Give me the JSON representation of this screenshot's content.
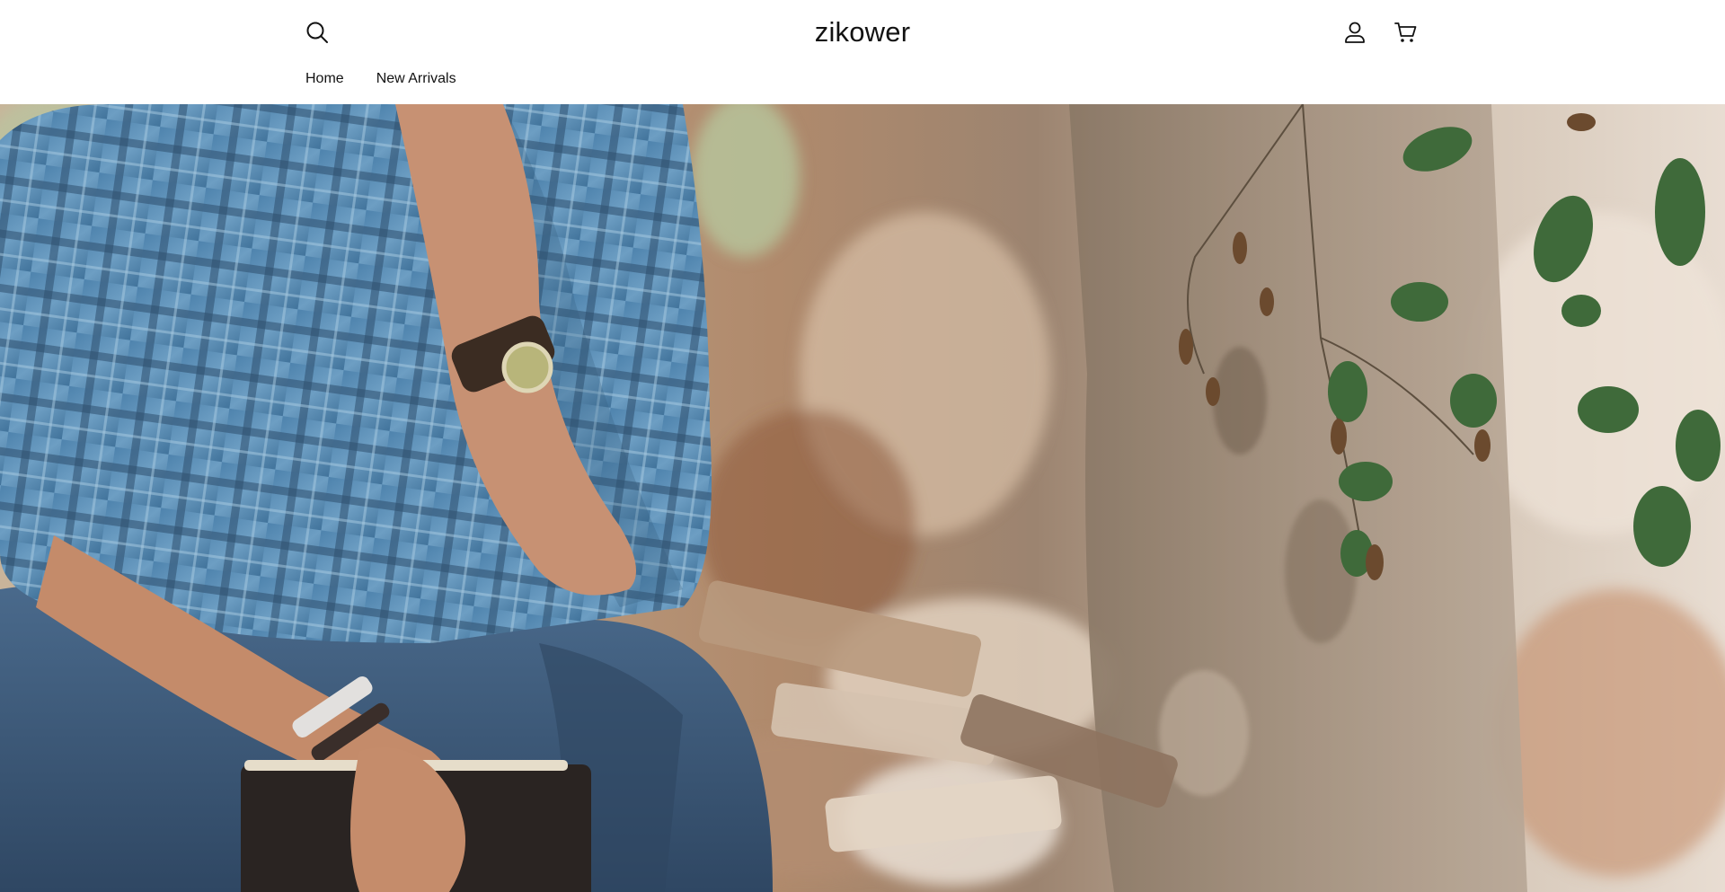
{
  "store": {
    "name": "zikower"
  },
  "header": {
    "icons": {
      "search": "search-icon",
      "account": "account-icon",
      "cart": "cart-icon"
    }
  },
  "nav": {
    "items": [
      {
        "label": "Home"
      },
      {
        "label": "New Arrivals"
      }
    ]
  },
  "hero": {
    "image_description_icon": "hero-image",
    "colors": {
      "shirt": "#5b8db5",
      "jeans": "#3a5675",
      "background": "#c7a88c"
    }
  }
}
